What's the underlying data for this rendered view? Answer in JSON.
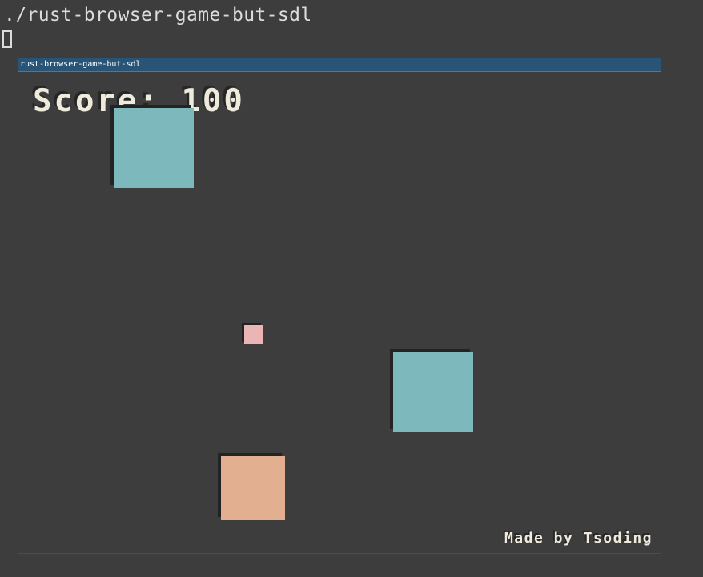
{
  "terminal": {
    "command": "./rust-browser-game-but-sdl"
  },
  "window": {
    "title": "rust-browser-game-but-sdl",
    "titlebar_color": "#285577"
  },
  "game": {
    "score_text": "Score: 100",
    "credit_text": "Made by Tsoding",
    "objects": [
      {
        "role": "enemy-block",
        "color": "#7db8bc"
      },
      {
        "role": "enemy-block",
        "color": "#7db8bc"
      },
      {
        "role": "player-block",
        "color": "#e2b090"
      },
      {
        "role": "projectile",
        "color": "#ecb5b5"
      }
    ]
  }
}
